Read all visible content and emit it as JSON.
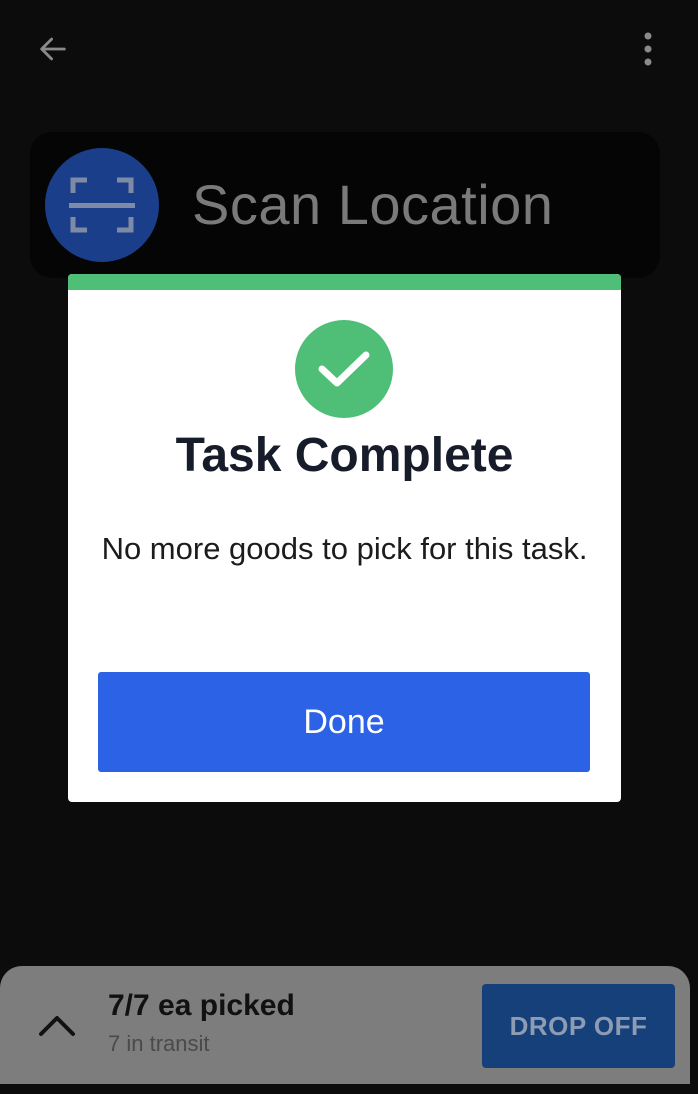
{
  "app_bar": {
    "back_icon": "arrow-left-icon",
    "menu_icon": "more-vertical-icon"
  },
  "scan_card": {
    "icon": "scan-barcode-icon",
    "title": "Scan Location"
  },
  "modal": {
    "icon": "check-circle-icon",
    "title": "Task Complete",
    "message": "No more goods to pick for this task.",
    "done_label": "Done"
  },
  "bottom_bar": {
    "expand_icon": "chevron-up-icon",
    "picked": "7/7 ea picked",
    "in_transit": "7 in transit",
    "dropoff_label": "DROP OFF"
  },
  "colors": {
    "success": "#4fbf77",
    "primary": "#2b62e6",
    "scan_circle": "#1b3e8a",
    "dropoff": "#16407a"
  }
}
